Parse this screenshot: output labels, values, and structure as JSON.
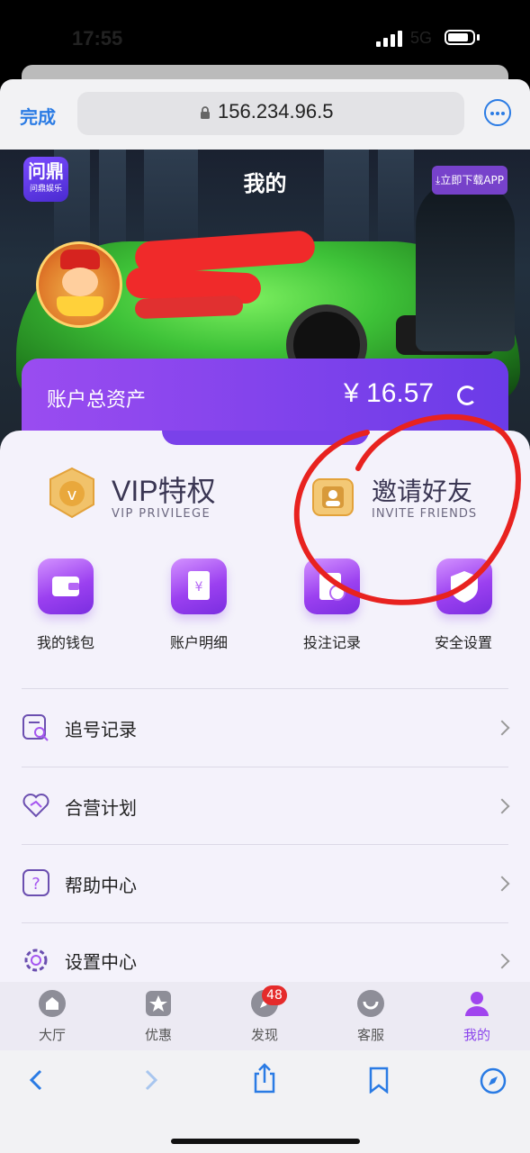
{
  "status_bar": {
    "time": "17:55",
    "network": "5G"
  },
  "browser": {
    "done_label": "完成",
    "url": "156.234.96.5",
    "more_icon": "ellipsis-circle-icon"
  },
  "header": {
    "app_logo_main": "问鼎",
    "app_logo_sub": "问鼎娱乐",
    "title": "我的",
    "download_label": "立即下载APP"
  },
  "account": {
    "total_assets_label": "账户总资产",
    "total_assets_value": "¥ 16.57"
  },
  "features": {
    "vip": {
      "title": "VIP特权",
      "subtitle": "VIP PRIVILEGE"
    },
    "invite": {
      "title": "邀请好友",
      "subtitle": "INVITE FRIENDS"
    }
  },
  "grid": [
    {
      "label": "我的钱包",
      "icon": "wallet-icon"
    },
    {
      "label": "账户明细",
      "icon": "bill-icon"
    },
    {
      "label": "投注记录",
      "icon": "bet-record-icon"
    },
    {
      "label": "安全设置",
      "icon": "shield-icon"
    }
  ],
  "menu": [
    {
      "label": "追号记录",
      "icon": "search-record-icon"
    },
    {
      "label": "合营计划",
      "icon": "partnership-icon"
    },
    {
      "label": "帮助中心",
      "icon": "help-icon"
    },
    {
      "label": "设置中心",
      "icon": "settings-icon"
    }
  ],
  "tabs": [
    {
      "label": "大厅",
      "icon": "home-icon"
    },
    {
      "label": "优惠",
      "icon": "star-icon"
    },
    {
      "label": "发现",
      "icon": "discover-icon",
      "badge": "48"
    },
    {
      "label": "客服",
      "icon": "support-icon"
    },
    {
      "label": "我的",
      "icon": "profile-icon",
      "active": true
    }
  ],
  "colors": {
    "accent": "#8b45ec",
    "browser_blue": "#2a7be4",
    "annotation": "#e8221f"
  }
}
